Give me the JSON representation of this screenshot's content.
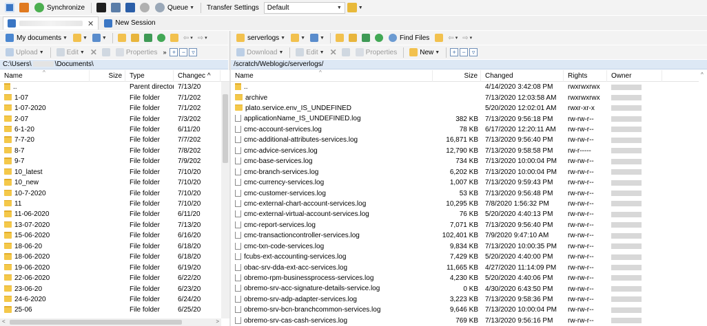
{
  "toolbar": {
    "synchronize_label": "Synchronize",
    "queue_label": "Queue",
    "transfer_settings_label": "Transfer Settings",
    "transfer_settings_value": "Default"
  },
  "tabs": {
    "new_session_label": "New Session"
  },
  "left_pane": {
    "location_label": "My documents",
    "upload_label": "Upload",
    "edit_label": "Edit",
    "properties_label": "Properties",
    "path_prefix": "C:\\Users\\",
    "path_suffix": "\\Documents\\",
    "columns": {
      "name": "Name",
      "size": "Size",
      "type": "Type",
      "changed": "Changec"
    },
    "rows": [
      {
        "name": "..",
        "size": "",
        "type": "Parent directory",
        "changed": "7/13/20",
        "icon": "parent"
      },
      {
        "name": "1-07",
        "size": "",
        "type": "File folder",
        "changed": "7/1/202",
        "icon": "folder"
      },
      {
        "name": "1-07-2020",
        "size": "",
        "type": "File folder",
        "changed": "7/1/202",
        "icon": "folder"
      },
      {
        "name": "2-07",
        "size": "",
        "type": "File folder",
        "changed": "7/3/202",
        "icon": "folder"
      },
      {
        "name": "6-1-20",
        "size": "",
        "type": "File folder",
        "changed": "6/11/20",
        "icon": "folder"
      },
      {
        "name": "7-7-20",
        "size": "",
        "type": "File folder",
        "changed": "7/7/202",
        "icon": "folder"
      },
      {
        "name": "8-7",
        "size": "",
        "type": "File folder",
        "changed": "7/8/202",
        "icon": "folder"
      },
      {
        "name": "9-7",
        "size": "",
        "type": "File folder",
        "changed": "7/9/202",
        "icon": "folder"
      },
      {
        "name": "10_latest",
        "size": "",
        "type": "File folder",
        "changed": "7/10/20",
        "icon": "folder"
      },
      {
        "name": "10_new",
        "size": "",
        "type": "File folder",
        "changed": "7/10/20",
        "icon": "folder"
      },
      {
        "name": "10-7-2020",
        "size": "",
        "type": "File folder",
        "changed": "7/10/20",
        "icon": "folder"
      },
      {
        "name": "11",
        "size": "",
        "type": "File folder",
        "changed": "7/10/20",
        "icon": "folder"
      },
      {
        "name": "11-06-2020",
        "size": "",
        "type": "File folder",
        "changed": "6/11/20",
        "icon": "folder"
      },
      {
        "name": "13-07-2020",
        "size": "",
        "type": "File folder",
        "changed": "7/13/20",
        "icon": "folder"
      },
      {
        "name": "15-06-2020",
        "size": "",
        "type": "File folder",
        "changed": "6/16/20",
        "icon": "folder"
      },
      {
        "name": "18-06-20",
        "size": "",
        "type": "File folder",
        "changed": "6/18/20",
        "icon": "folder"
      },
      {
        "name": "18-06-2020",
        "size": "",
        "type": "File folder",
        "changed": "6/18/20",
        "icon": "folder"
      },
      {
        "name": "19-06-2020",
        "size": "",
        "type": "File folder",
        "changed": "6/19/20",
        "icon": "folder"
      },
      {
        "name": "22-06-2020",
        "size": "",
        "type": "File folder",
        "changed": "6/22/20",
        "icon": "folder"
      },
      {
        "name": "23-06-20",
        "size": "",
        "type": "File folder",
        "changed": "6/23/20",
        "icon": "folder"
      },
      {
        "name": "24-6-2020",
        "size": "",
        "type": "File folder",
        "changed": "6/24/20",
        "icon": "folder"
      },
      {
        "name": "25-06",
        "size": "",
        "type": "File folder",
        "changed": "6/25/20",
        "icon": "folder"
      }
    ]
  },
  "right_pane": {
    "location_label": "serverlogs",
    "find_files_label": "Find Files",
    "download_label": "Download",
    "edit_label": "Edit",
    "properties_label": "Properties",
    "new_label": "New",
    "path": "/scratch/Weblogic/serverlogs/",
    "columns": {
      "name": "Name",
      "size": "Size",
      "changed": "Changed",
      "rights": "Rights",
      "owner": "Owner"
    },
    "rows": [
      {
        "name": "..",
        "size": "",
        "changed": "4/14/2020 3:42:08 PM",
        "rights": "rwxrwxrwx",
        "icon": "parent"
      },
      {
        "name": "archive",
        "size": "",
        "changed": "7/13/2020 12:03:58 AM",
        "rights": "rwxrwxrwx",
        "icon": "folder"
      },
      {
        "name": "plato.service.env_IS_UNDEFINED",
        "size": "",
        "changed": "5/20/2020 12:02:01 AM",
        "rights": "rwxr-xr-x",
        "icon": "folder"
      },
      {
        "name": "applicationName_IS_UNDEFINED.log",
        "size": "382 KB",
        "changed": "7/13/2020 9:56:18 PM",
        "rights": "rw-rw-r--",
        "icon": "file"
      },
      {
        "name": "cmc-account-services.log",
        "size": "78 KB",
        "changed": "6/17/2020 12:20:11 AM",
        "rights": "rw-rw-r--",
        "icon": "file"
      },
      {
        "name": "cmc-additional-attributes-services.log",
        "size": "16,871 KB",
        "changed": "7/13/2020 9:56:40 PM",
        "rights": "rw-rw-r--",
        "icon": "file"
      },
      {
        "name": "cmc-advice-services.log",
        "size": "12,790 KB",
        "changed": "7/13/2020 9:58:58 PM",
        "rights": "rw-r-----",
        "icon": "file"
      },
      {
        "name": "cmc-base-services.log",
        "size": "734 KB",
        "changed": "7/13/2020 10:00:04 PM",
        "rights": "rw-rw-r--",
        "icon": "file"
      },
      {
        "name": "cmc-branch-services.log",
        "size": "6,202 KB",
        "changed": "7/13/2020 10:00:04 PM",
        "rights": "rw-rw-r--",
        "icon": "file"
      },
      {
        "name": "cmc-currency-services.log",
        "size": "1,007 KB",
        "changed": "7/13/2020 9:59:43 PM",
        "rights": "rw-rw-r--",
        "icon": "file"
      },
      {
        "name": "cmc-customer-services.log",
        "size": "53 KB",
        "changed": "7/13/2020 9:56:48 PM",
        "rights": "rw-rw-r--",
        "icon": "file"
      },
      {
        "name": "cmc-external-chart-account-services.log",
        "size": "10,295 KB",
        "changed": "7/8/2020 1:56:32 PM",
        "rights": "rw-rw-r--",
        "icon": "file"
      },
      {
        "name": "cmc-external-virtual-account-services.log",
        "size": "76 KB",
        "changed": "5/20/2020 4:40:13 PM",
        "rights": "rw-rw-r--",
        "icon": "file"
      },
      {
        "name": "cmc-report-services.log",
        "size": "7,071 KB",
        "changed": "7/13/2020 9:56:40 PM",
        "rights": "rw-rw-r--",
        "icon": "file"
      },
      {
        "name": "cmc-transactioncontroller-services.log",
        "size": "102,401 KB",
        "changed": "7/9/2020 9:47:10 AM",
        "rights": "rw-rw-r--",
        "icon": "file"
      },
      {
        "name": "cmc-txn-code-services.log",
        "size": "9,834 KB",
        "changed": "7/13/2020 10:00:35 PM",
        "rights": "rw-rw-r--",
        "icon": "file"
      },
      {
        "name": "fcubs-ext-accounting-services.log",
        "size": "7,429 KB",
        "changed": "5/20/2020 4:40:00 PM",
        "rights": "rw-rw-r--",
        "icon": "file"
      },
      {
        "name": "obac-srv-dda-ext-acc-services.log",
        "size": "11,665 KB",
        "changed": "4/27/2020 11:14:09 PM",
        "rights": "rw-rw-r--",
        "icon": "file"
      },
      {
        "name": "obremo-rpm-businessprocess-services.log",
        "size": "4,230 KB",
        "changed": "5/20/2020 4:40:06 PM",
        "rights": "rw-rw-r--",
        "icon": "file"
      },
      {
        "name": "obremo-srv-acc-signature-details-service.log",
        "size": "0 KB",
        "changed": "4/30/2020 6:43:50 PM",
        "rights": "rw-rw-r--",
        "icon": "file"
      },
      {
        "name": "obremo-srv-adp-adapter-services.log",
        "size": "3,223 KB",
        "changed": "7/13/2020 9:58:36 PM",
        "rights": "rw-rw-r--",
        "icon": "file"
      },
      {
        "name": "obremo-srv-bcn-branchcommon-services.log",
        "size": "9,646 KB",
        "changed": "7/13/2020 10:00:04 PM",
        "rights": "rw-rw-r--",
        "icon": "file"
      },
      {
        "name": "obremo-srv-cas-cash-services.log",
        "size": "769 KB",
        "changed": "7/13/2020 9:56:16 PM",
        "rights": "rw-rw-r--",
        "icon": "file"
      }
    ]
  }
}
